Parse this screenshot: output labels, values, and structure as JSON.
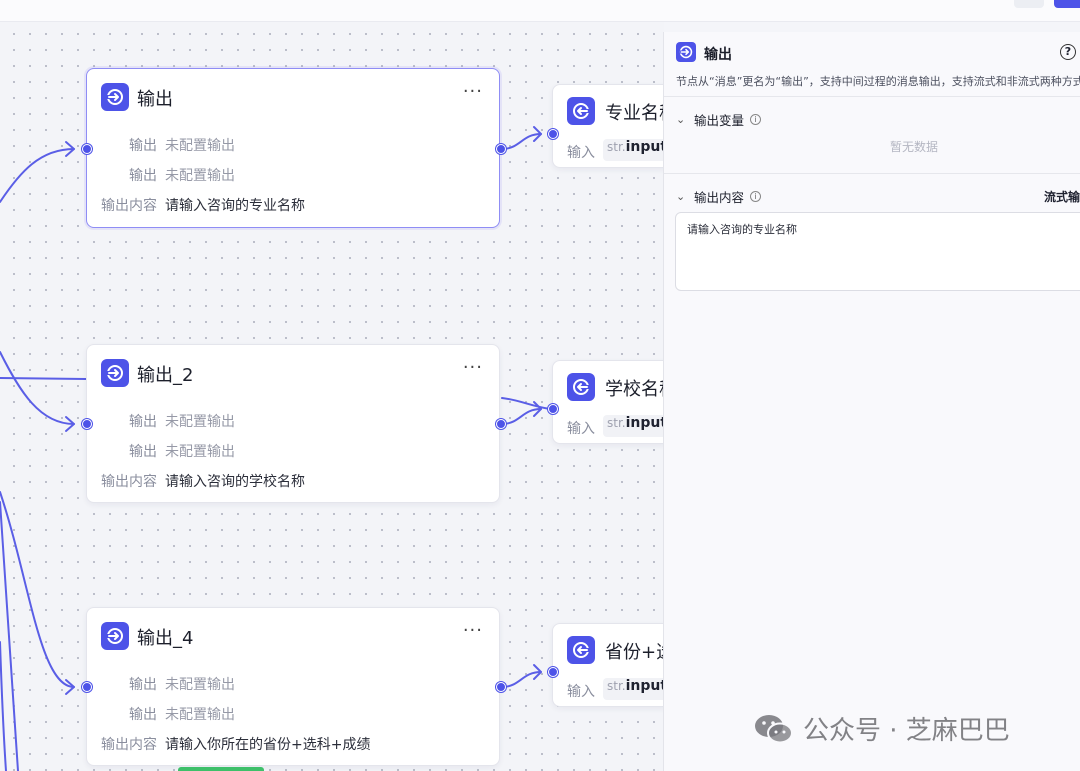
{
  "nodes": [
    {
      "title": "输出",
      "more": "···",
      "rows": [
        {
          "label": "输出",
          "value": "未配置输出"
        },
        {
          "label": "输出",
          "value": "未配置输出"
        },
        {
          "label": "输出内容",
          "value": "请输入咨询的专业名称"
        }
      ]
    },
    {
      "title": "输出_2",
      "more": "···",
      "rows": [
        {
          "label": "输出",
          "value": "未配置输出"
        },
        {
          "label": "输出",
          "value": "未配置输出"
        },
        {
          "label": "输出内容",
          "value": "请输入咨询的学校名称"
        }
      ]
    },
    {
      "title": "输出_4",
      "more": "···",
      "rows": [
        {
          "label": "输出",
          "value": "未配置输出"
        },
        {
          "label": "输出",
          "value": "未配置输出"
        },
        {
          "label": "输出内容",
          "value": "请输入你所在的省份+选科+成绩"
        }
      ]
    }
  ],
  "input_nodes": [
    {
      "title": "专业名称",
      "input_label": "输入",
      "type_tag": "str.",
      "value": "input"
    },
    {
      "title": "学校名称",
      "input_label": "输入",
      "type_tag": "str.",
      "value": "input"
    },
    {
      "title": "省份+选科",
      "input_label": "输入",
      "type_tag": "str.",
      "value": "input"
    }
  ],
  "panel": {
    "title": "输出",
    "help": "?",
    "description": "节点从“消息”更名为“输出”，支持中间过程的消息输出，支持流式和非流式两种方式",
    "vars_section": "输出变量",
    "vars_empty": "暂无数据",
    "content_section": "输出内容",
    "stream_label": "流式输出",
    "content_value": "请输入咨询的专业名称"
  },
  "watermark": {
    "text": "公众号 · 芝麻巴巴"
  },
  "colors": {
    "accent": "#4d53e8",
    "edge": "#5a5ee6",
    "selected_border": "#8f8df5"
  },
  "icons": {
    "node": "output-arrow-icon",
    "input_node": "input-arrow-icon",
    "help": "question-circle-icon",
    "collapse": "chevron-down-icon",
    "info": "info-icon",
    "watermark": "wechat-icon"
  }
}
